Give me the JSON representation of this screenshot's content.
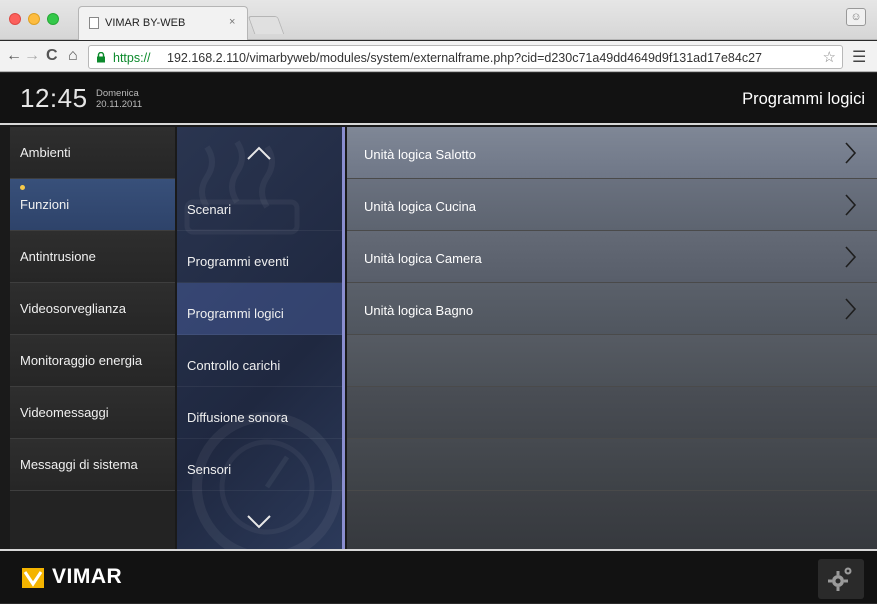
{
  "browser": {
    "tab_title": "VIMAR BY-WEB",
    "tab_close": "×",
    "url_scheme": "https://",
    "url_rest": "192.168.2.110/vimarbyweb/modules/system/externalframe.php?cid=d230c71a49dd4649d9f131ad17e84c27"
  },
  "header": {
    "time": "12:45",
    "day": "Domenica",
    "date": "20.11.2011",
    "page_title": "Programmi logici"
  },
  "left_menu": {
    "items": [
      {
        "label": "Ambienti",
        "active": false
      },
      {
        "label": "Funzioni",
        "active": true
      },
      {
        "label": "Antintrusione",
        "active": false
      },
      {
        "label": "Videosorveglianza",
        "active": false
      },
      {
        "label": "Monitoraggio energia",
        "active": false
      },
      {
        "label": "Videomessaggi",
        "active": false
      },
      {
        "label": "Messaggi di sistema",
        "active": false
      }
    ]
  },
  "sub_menu": {
    "items": [
      {
        "label": "Scenari",
        "active": false
      },
      {
        "label": "Programmi eventi",
        "active": false
      },
      {
        "label": "Programmi logici",
        "active": true
      },
      {
        "label": "Controllo carichi",
        "active": false
      },
      {
        "label": "Diffusione sonora",
        "active": false
      },
      {
        "label": "Sensori",
        "active": false
      }
    ]
  },
  "logic_units": {
    "items": [
      {
        "label": "Unità logica Salotto"
      },
      {
        "label": "Unità logica Cucina"
      },
      {
        "label": "Unità logica Camera"
      },
      {
        "label": "Unità logica Bagno"
      }
    ]
  },
  "footer": {
    "brand": "VIMAR"
  },
  "colors": {
    "accent_active": "#2e436a",
    "dot": "#f6c94a",
    "logo_yellow": "#f4b400"
  }
}
